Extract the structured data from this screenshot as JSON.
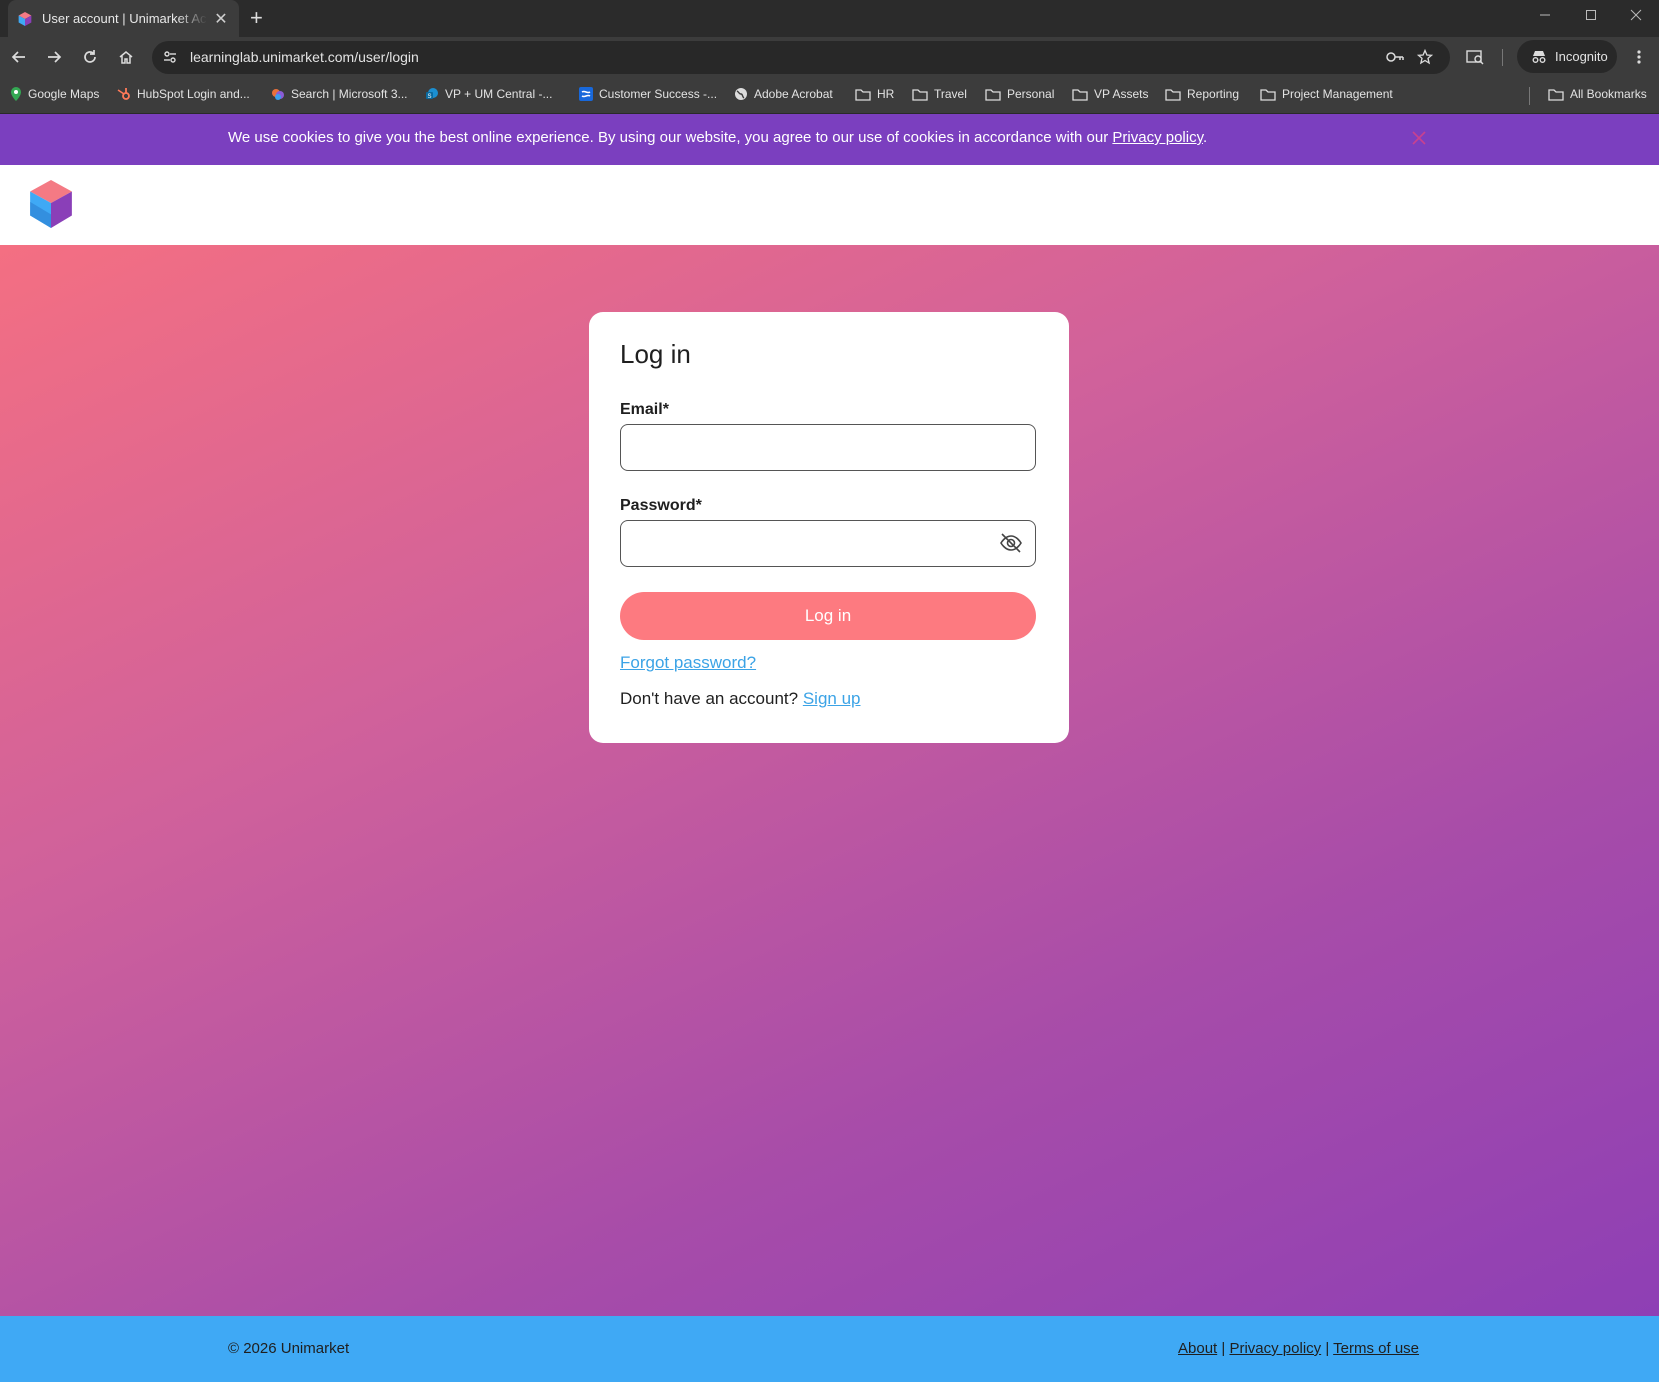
{
  "browser": {
    "tab_title": "User account | Unimarket Academy",
    "url": "learninglab.unimarket.com/user/login",
    "incognito_label": "Incognito",
    "bookmarks": [
      {
        "label": "Google Maps",
        "icon": "maps-pin-icon"
      },
      {
        "label": "HubSpot Login and...",
        "icon": "hubspot-icon"
      },
      {
        "label": "Search | Microsoft 3...",
        "icon": "microsoft-icon"
      },
      {
        "label": "VP + UM Central -...",
        "icon": "sharepoint-icon"
      },
      {
        "label": "Customer Success -...",
        "icon": "confluence-icon"
      },
      {
        "label": "Adobe Acrobat",
        "icon": "globe-icon"
      },
      {
        "label": "HR",
        "icon": "folder-icon"
      },
      {
        "label": "Travel",
        "icon": "folder-icon"
      },
      {
        "label": "Personal",
        "icon": "folder-icon"
      },
      {
        "label": "VP Assets",
        "icon": "folder-icon"
      },
      {
        "label": "Reporting",
        "icon": "folder-icon"
      },
      {
        "label": "Project Management",
        "icon": "folder-icon"
      }
    ],
    "all_bookmarks_label": "All Bookmarks"
  },
  "cookie_banner": {
    "text": "We use cookies to give you the best online experience. By using our website, you agree to our use of cookies in accordance with our ",
    "link_label": "Privacy policy",
    "suffix": "."
  },
  "login": {
    "title": "Log in",
    "email_label": "Email*",
    "email_value": "",
    "password_label": "Password*",
    "password_value": "",
    "submit_label": "Log in",
    "forgot_label": "Forgot password?",
    "signup_prompt": "Don't have an account?",
    "signup_label": "Sign up"
  },
  "footer": {
    "copyright": "© 2026 Unimarket",
    "links": [
      "About",
      "Privacy policy",
      "Terms of use"
    ],
    "separator": "|"
  },
  "colors": {
    "cookie_bar": "#7b3fbf",
    "gradient_start": "#f46f82",
    "gradient_end": "#8e3fb5",
    "primary_button": "#fd7a80",
    "link": "#3ba3e6",
    "footer": "#3fa9f5"
  }
}
